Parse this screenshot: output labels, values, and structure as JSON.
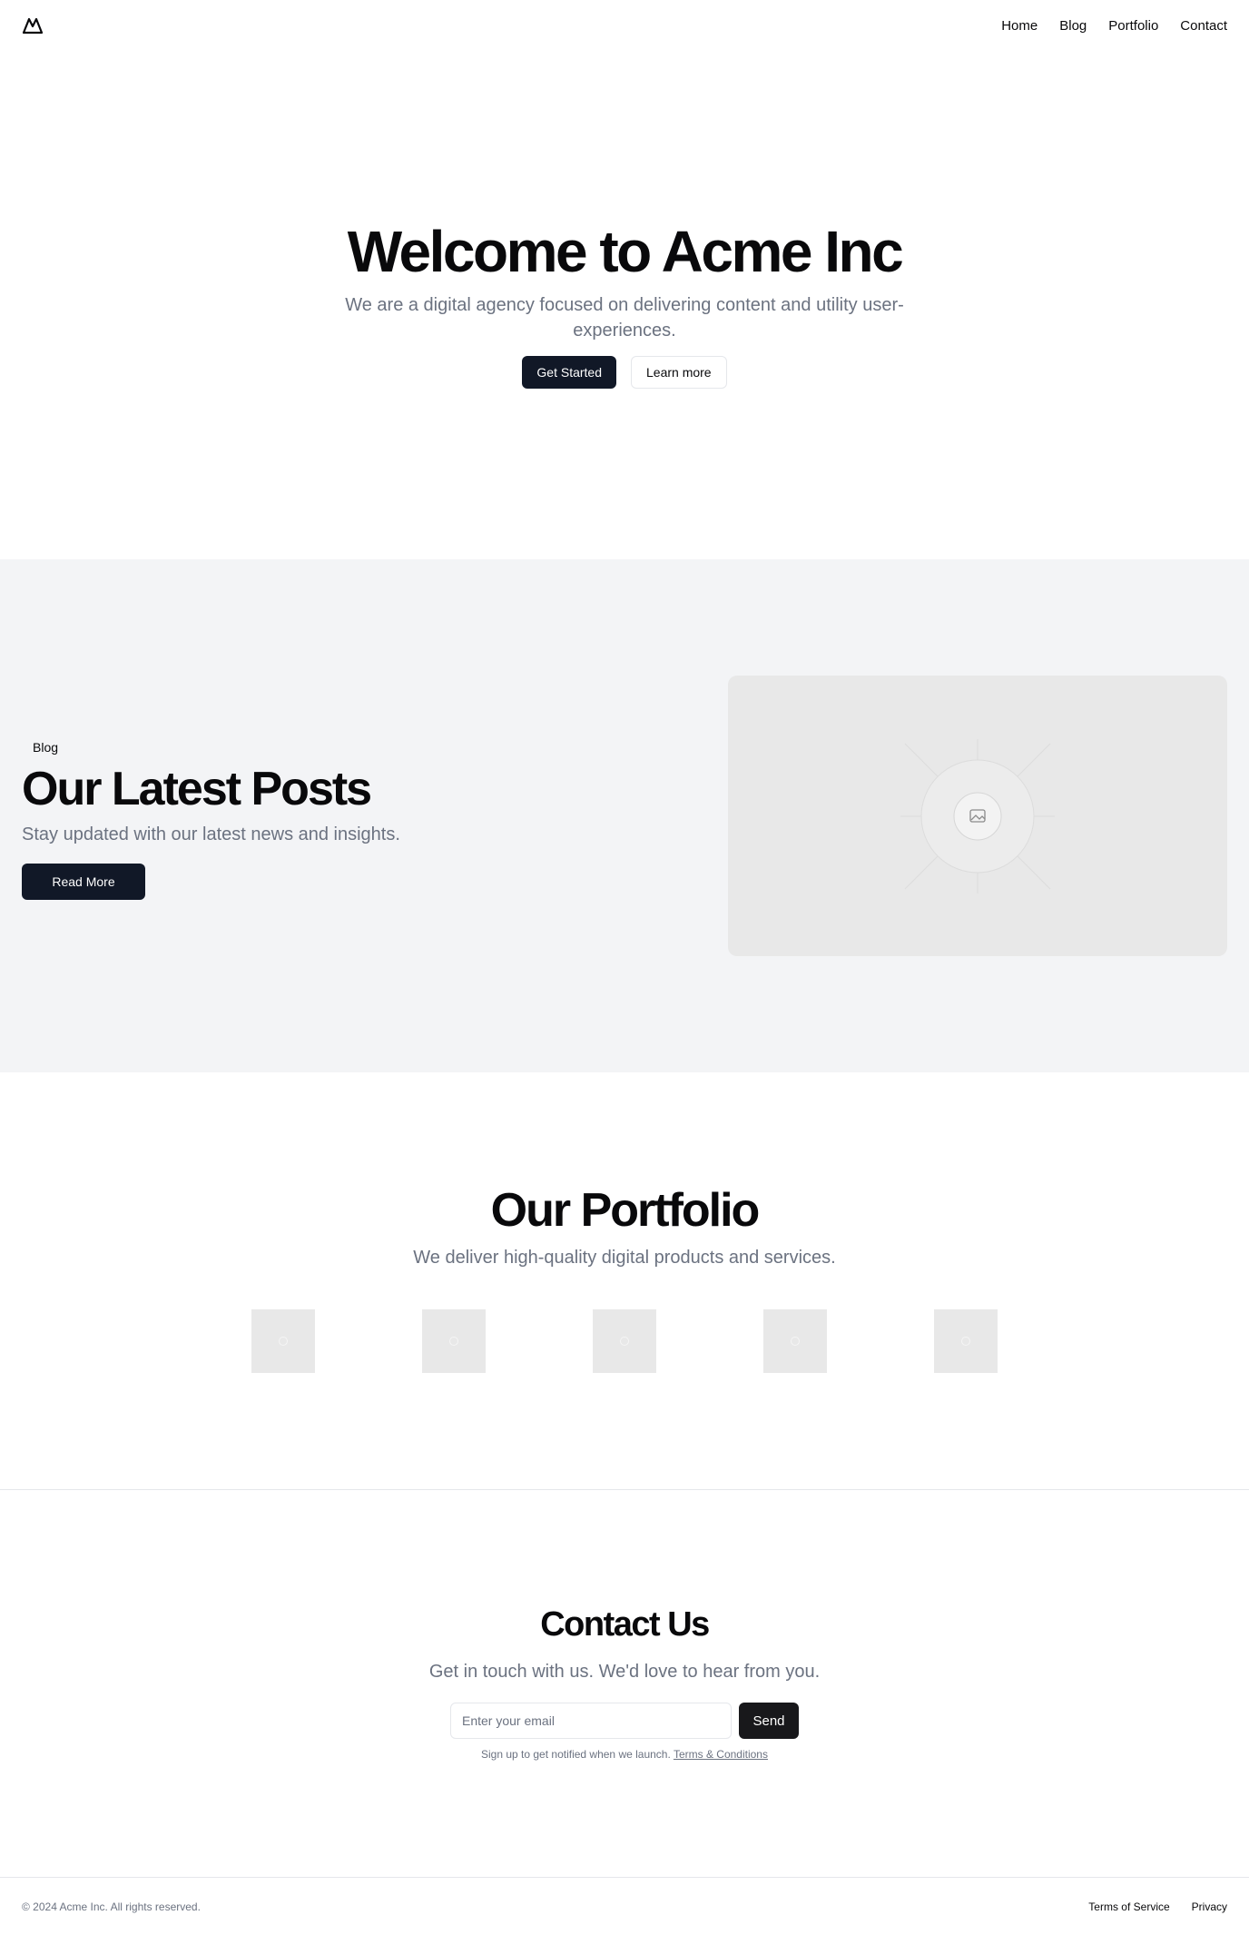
{
  "header": {
    "logo_icon": "mountain-icon",
    "nav": [
      "Home",
      "Blog",
      "Portfolio",
      "Contact"
    ]
  },
  "hero": {
    "title": "Welcome to Acme Inc",
    "subtitle": "We are a digital agency focused on delivering content and utility user-experiences.",
    "primary_button": "Get Started",
    "secondary_button": "Learn more"
  },
  "blog": {
    "tag": "Blog",
    "title": "Our Latest Posts",
    "subtitle": "Stay updated with our latest news and insights.",
    "button": "Read More",
    "image_icon": "image-placeholder-icon"
  },
  "portfolio": {
    "title": "Our Portfolio",
    "subtitle": "We deliver high-quality digital products and services.",
    "item_count": 5
  },
  "contact": {
    "title": "Contact Us",
    "subtitle": "Get in touch with us. We'd love to hear from you.",
    "email_placeholder": "Enter your email",
    "send_button": "Send",
    "fine_print": "Sign up to get notified when we launch.",
    "terms_link": "Terms & Conditions"
  },
  "footer": {
    "copyright": "© 2024 Acme Inc. All rights reserved.",
    "links": [
      "Terms of Service",
      "Privacy"
    ]
  },
  "colors": {
    "primary_dark": "#111827",
    "muted_text": "#6b7280",
    "section_bg": "#f3f4f6",
    "placeholder_bg": "#e8e8e8"
  }
}
